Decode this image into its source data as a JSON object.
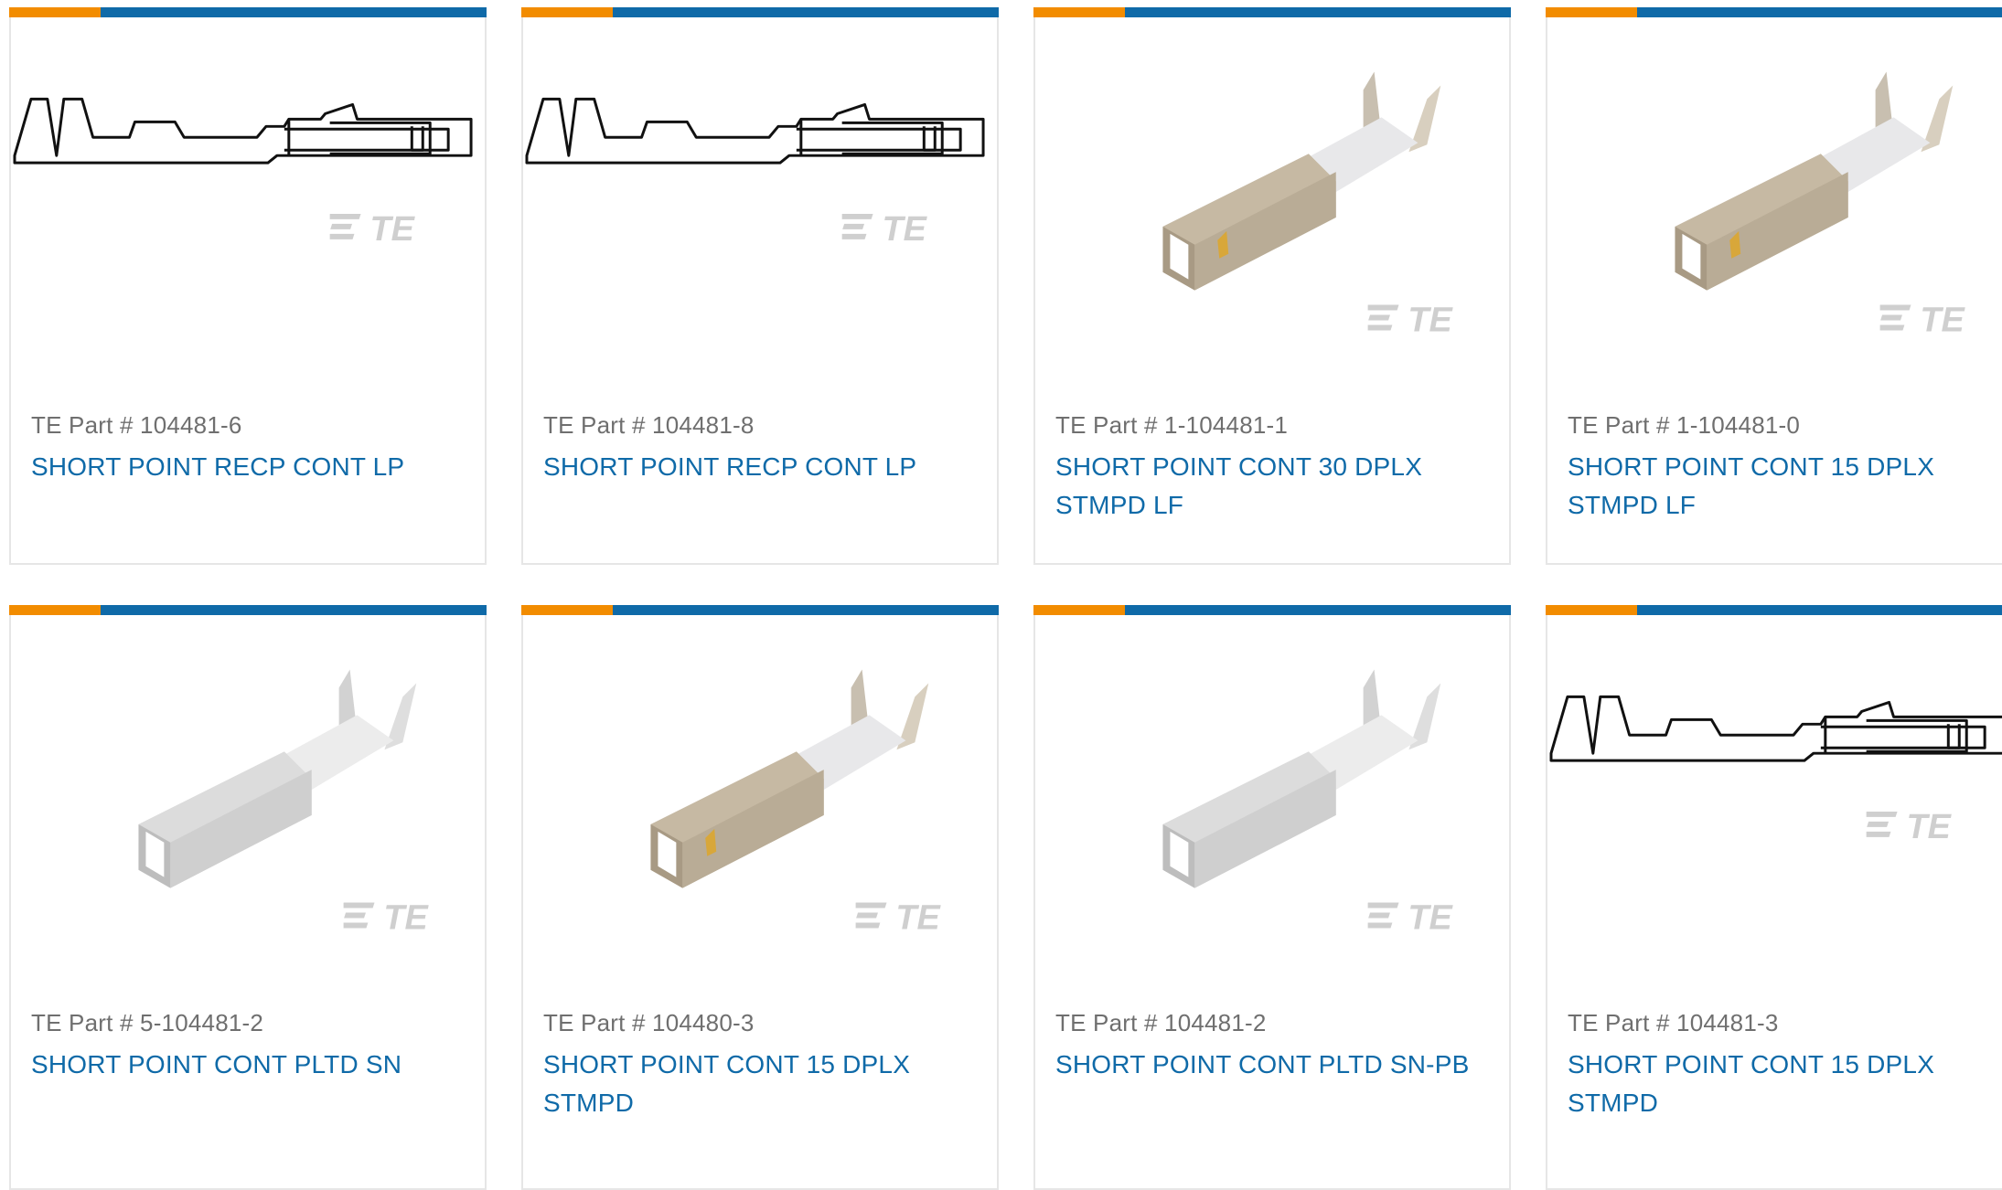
{
  "colors": {
    "accent_orange": "#f28c00",
    "accent_blue": "#0f6aa8",
    "link_blue": "#0f6aa8",
    "muted_text": "#6f6f6f",
    "card_border": "#e6e6e6"
  },
  "cards": [
    {
      "part_number": "TE Part # 104481-6",
      "title": "SHORT POINT RECP CONT LP",
      "image": "line-drawing",
      "brand": "TE"
    },
    {
      "part_number": "TE Part # 104481-8",
      "title": "SHORT POINT RECP CONT LP",
      "image": "line-drawing",
      "brand": "TE"
    },
    {
      "part_number": "TE Part # 1-104481-1",
      "title": "SHORT POINT CONT 30 DPLX STMPD LF",
      "image": "render-beige",
      "brand": "TE"
    },
    {
      "part_number": "TE Part # 1-104481-0",
      "title": "SHORT POINT CONT 15 DPLX STMPD LF",
      "image": "render-beige",
      "brand": "TE"
    },
    {
      "part_number": "TE Part # 5-104481-2",
      "title": "SHORT POINT CONT PLTD SN",
      "image": "render-silver",
      "brand": "TE"
    },
    {
      "part_number": "TE Part # 104480-3",
      "title": "SHORT POINT CONT 15 DPLX STMPD",
      "image": "render-beige",
      "brand": "TE"
    },
    {
      "part_number": "TE Part # 104481-2",
      "title": "SHORT POINT CONT PLTD SN-PB",
      "image": "render-silver",
      "brand": "TE"
    },
    {
      "part_number": "TE Part # 104481-3",
      "title": "SHORT POINT CONT 15 DPLX STMPD",
      "image": "line-drawing",
      "brand": "TE"
    }
  ]
}
